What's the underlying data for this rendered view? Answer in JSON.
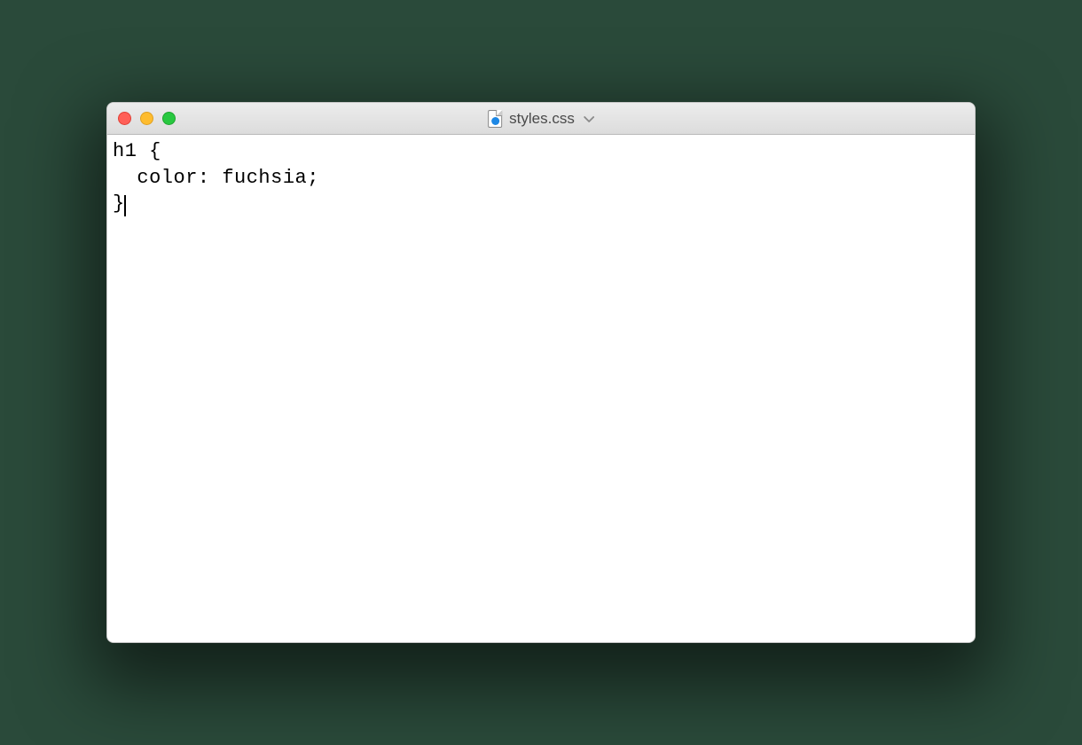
{
  "window": {
    "title": "styles.css"
  },
  "traffic_lights": {
    "close": "close",
    "minimize": "minimize",
    "maximize": "maximize"
  },
  "editor": {
    "lines": [
      "h1 {",
      "  color: fuchsia;",
      "}"
    ],
    "content": "h1 {\n  color: fuchsia;\n}"
  }
}
